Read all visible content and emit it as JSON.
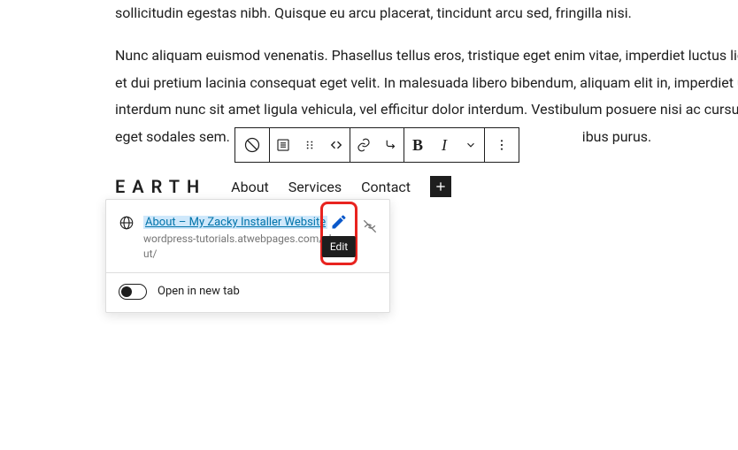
{
  "paragraphs": {
    "p1": "sollicitudin egestas nibh. Quisque eu arcu placerat, tincidunt arcu sed, fringilla nisi.",
    "p2a": "Nunc aliquam euismod venenatis. Phasellus tellus eros, tristique eget enim vitae, imperdiet luctus ligula.",
    "p2b": "et dui pretium lacinia consequat eget velit. In malesuada libero bibendum, aliquam elit in, imperdiet urna",
    "p2c": "interdum nunc sit amet ligula vehicula, vel efficitur dolor interdum. Vestibulum posuere nisi ac cursus su",
    "p2d_left": "eget sodales sem.",
    "p2d_right": "ibus purus."
  },
  "toolbar": {
    "bold": "B",
    "italic": "I"
  },
  "nav": {
    "site_title": "EARTH",
    "items": [
      "About",
      "Services",
      "Contact"
    ]
  },
  "popover": {
    "link_title": "About – My Zacky Installer Website",
    "link_url": "wordpress-tutorials.atwebpages.com/about/",
    "tooltip_edit": "Edit",
    "open_new_tab": "Open in new tab"
  }
}
